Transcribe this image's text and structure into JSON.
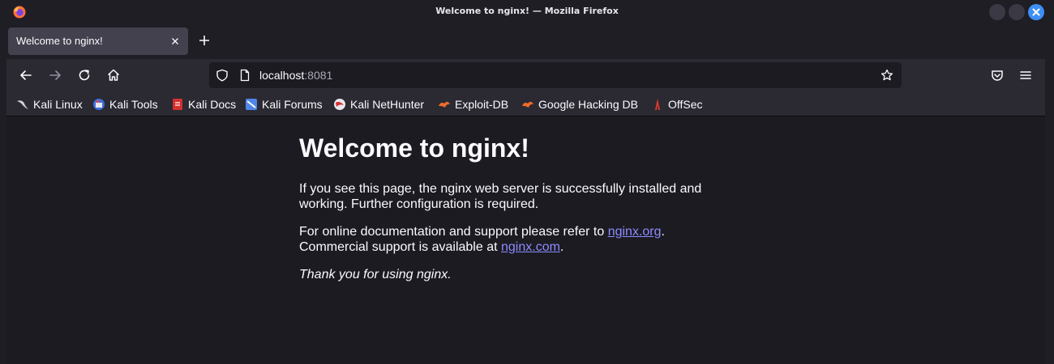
{
  "window": {
    "title": "Welcome to nginx! — Mozilla Firefox"
  },
  "tab": {
    "label": "Welcome to nginx!"
  },
  "url": {
    "host": "localhost",
    "port": ":8081"
  },
  "bookmarks": [
    {
      "label": "Kali Linux",
      "icon": "kali-dragon-icon"
    },
    {
      "label": "Kali Tools",
      "icon": "kali-tools-icon"
    },
    {
      "label": "Kali Docs",
      "icon": "kali-docs-icon"
    },
    {
      "label": "Kali Forums",
      "icon": "kali-forums-icon"
    },
    {
      "label": "Kali NetHunter",
      "icon": "kali-nethunter-icon"
    },
    {
      "label": "Exploit-DB",
      "icon": "exploit-db-icon"
    },
    {
      "label": "Google Hacking DB",
      "icon": "google-hacking-db-icon"
    },
    {
      "label": "OffSec",
      "icon": "offsec-icon"
    }
  ],
  "page": {
    "heading": "Welcome to nginx!",
    "p1": "If you see this page, the nginx web server is successfully installed and working. Further configuration is required.",
    "p2_prefix": "For online documentation and support please refer to ",
    "p2_link": "nginx.org",
    "p2_suffix": ".",
    "p3_prefix": "Commercial support is available at ",
    "p3_link": "nginx.com",
    "p3_suffix": ".",
    "thanks": "Thank you for using nginx."
  },
  "colors": {
    "accent": "#3d8ff4",
    "link": "#8c8cff",
    "page_bg": "#1c1b22"
  }
}
